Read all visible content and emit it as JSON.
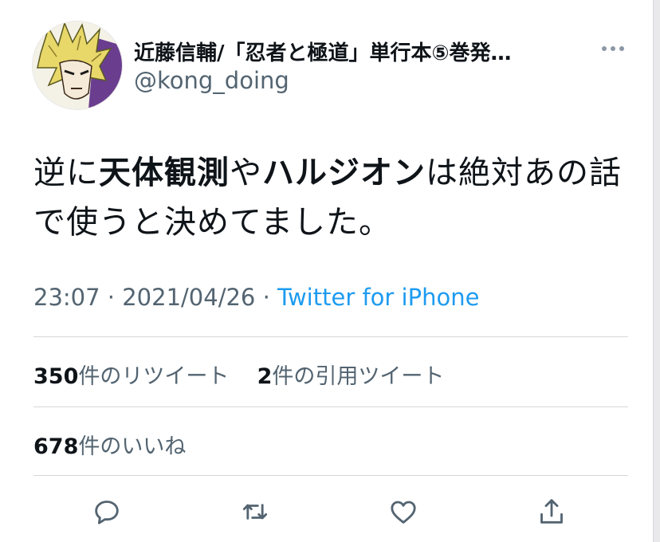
{
  "tweet": {
    "display_name": "近藤信輔/「忍者と極道」単行本⑤巻発…",
    "handle": "@kong_doing",
    "text_segments": [
      {
        "text": "逆に",
        "bold": false
      },
      {
        "text": "天体観測",
        "bold": true
      },
      {
        "text": "や",
        "bold": false
      },
      {
        "text": "ハルジオン",
        "bold": true
      },
      {
        "text": "は絶対あの話で使うと決めてました。",
        "bold": false
      }
    ],
    "time": "23:07",
    "separator": " · ",
    "date": "2021/04/26",
    "source": "Twitter for iPhone"
  },
  "stats": {
    "retweets_count": "350",
    "retweets_label": "件のリツイート",
    "quotes_count": "2",
    "quotes_label": "件の引用ツイート",
    "likes_count": "678",
    "likes_label": "件のいいね"
  },
  "icons": {
    "more": "more-horizontal-icon",
    "reply": "reply-icon",
    "retweet": "retweet-icon",
    "like": "heart-icon",
    "share": "share-icon"
  },
  "colors": {
    "text": "#0f1419",
    "secondary": "#536471",
    "link": "#1d9bf0",
    "divider": "#d4d7da"
  }
}
